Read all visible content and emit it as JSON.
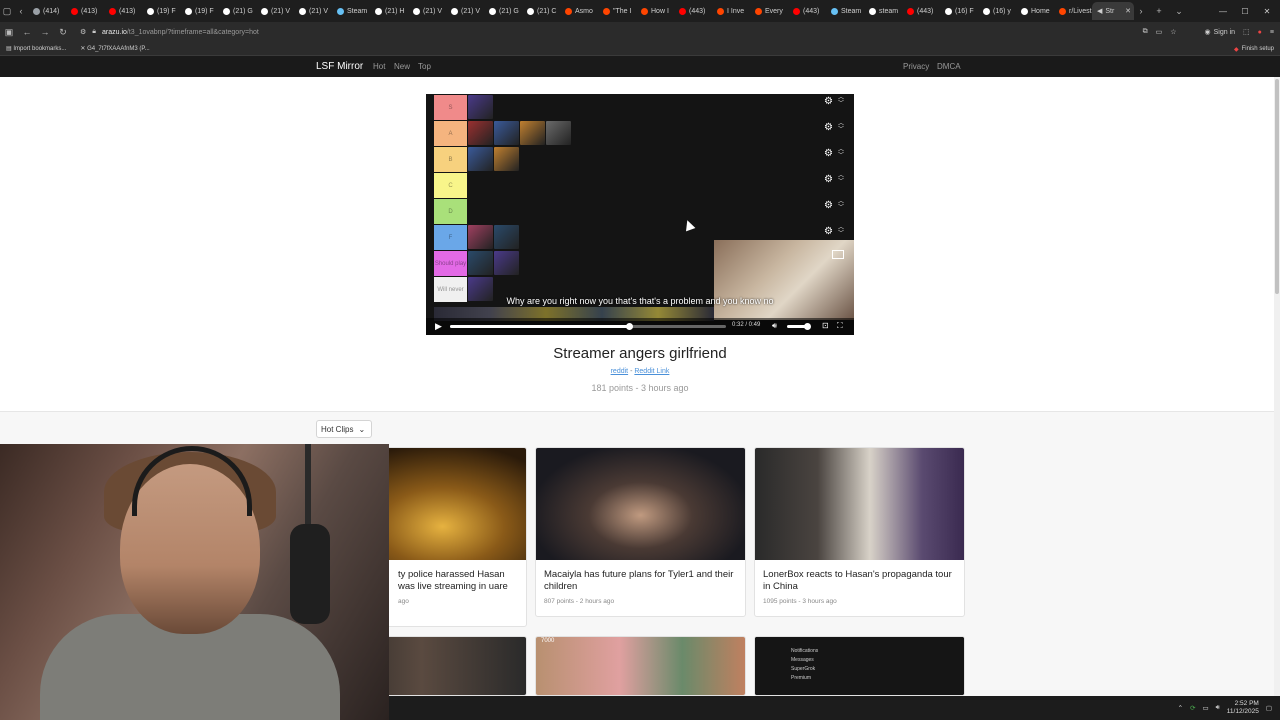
{
  "browser": {
    "tabs": [
      {
        "label": "(414)",
        "icon": "circle-icon",
        "color": "#9aa0a6"
      },
      {
        "label": "(413)",
        "icon": "youtube-icon",
        "color": "#ff0000"
      },
      {
        "label": "(413)",
        "icon": "youtube-icon",
        "color": "#ff0000"
      },
      {
        "label": "(19) F",
        "icon": "x-icon",
        "color": "#ffffff"
      },
      {
        "label": "(19) F",
        "icon": "x-icon",
        "color": "#ffffff"
      },
      {
        "label": "(21) G",
        "icon": "x-icon",
        "color": "#ffffff"
      },
      {
        "label": "(21) V",
        "icon": "x-icon",
        "color": "#ffffff"
      },
      {
        "label": "(21) V",
        "icon": "x-icon",
        "color": "#ffffff"
      },
      {
        "label": "Steam",
        "icon": "steam-icon",
        "color": "#66c0f4"
      },
      {
        "label": "(21) H",
        "icon": "x-icon",
        "color": "#ffffff"
      },
      {
        "label": "(21) V",
        "icon": "x-icon",
        "color": "#ffffff"
      },
      {
        "label": "(21) V",
        "icon": "x-icon",
        "color": "#ffffff"
      },
      {
        "label": "(21) G",
        "icon": "x-icon",
        "color": "#ffffff"
      },
      {
        "label": "(21) C",
        "icon": "x-icon",
        "color": "#ffffff"
      },
      {
        "label": "Asmo",
        "icon": "reddit-icon",
        "color": "#ff4500"
      },
      {
        "label": "\"The I",
        "icon": "reddit-icon",
        "color": "#ff4500"
      },
      {
        "label": "How I",
        "icon": "reddit-icon",
        "color": "#ff4500"
      },
      {
        "label": "(443)",
        "icon": "youtube-icon",
        "color": "#ff0000"
      },
      {
        "label": "I Inve",
        "icon": "reddit-icon",
        "color": "#ff4500"
      },
      {
        "label": "Every",
        "icon": "reddit-icon",
        "color": "#ff4500"
      },
      {
        "label": "(443)",
        "icon": "youtube-icon",
        "color": "#ff0000"
      },
      {
        "label": "Steam",
        "icon": "steam-icon",
        "color": "#66c0f4"
      },
      {
        "label": "steam",
        "icon": "google-icon",
        "color": "#ffffff"
      },
      {
        "label": "(443)",
        "icon": "youtube-icon",
        "color": "#ff0000"
      },
      {
        "label": "(16) F",
        "icon": "x-icon",
        "color": "#ffffff"
      },
      {
        "label": "(16) y",
        "icon": "x-icon",
        "color": "#ffffff"
      },
      {
        "label": "Home",
        "icon": "x-icon",
        "color": "#ffffff"
      },
      {
        "label": "r/Livest",
        "icon": "reddit-icon",
        "color": "#ff4500"
      }
    ],
    "active_tab": {
      "label": "Str",
      "icon": "speaker-icon"
    },
    "new_tab": "+",
    "url_host": "arazu.io",
    "url_path": "/t3_1ovabnp/?timeframe=all&category=hot",
    "sign_in": "Sign in",
    "bookmarks": [
      "Import bookmarks...",
      "G4_7t7fXAAAfnM3 (P..."
    ],
    "finish_setup": "Finish setup",
    "window_controls": {
      "minimize": "—",
      "maximize": "☐",
      "close": "✕"
    }
  },
  "site": {
    "brand": "LSF Mirror",
    "nav": [
      "Hot",
      "New",
      "Top"
    ],
    "nav_right": [
      "Privacy",
      "DMCA"
    ]
  },
  "video": {
    "tiers": [
      {
        "label": "S",
        "color": "#f08a8a"
      },
      {
        "label": "A",
        "color": "#f5b47f"
      },
      {
        "label": "B",
        "color": "#f7d17e"
      },
      {
        "label": "C",
        "color": "#f8f58a"
      },
      {
        "label": "D",
        "color": "#a9e07a"
      },
      {
        "label": "F",
        "color": "#6aa7e8"
      },
      {
        "label": "Should play",
        "color": "#e36ae6"
      },
      {
        "label": "Will never",
        "color": "#f0f0f0"
      }
    ],
    "subtitle": "Why are you right now you that's that's a problem and you know no",
    "time": "0:32 / 0:49",
    "progress": 0.65,
    "volume": 0.8
  },
  "post": {
    "title": "Streamer angers girlfriend",
    "link1": "reddit",
    "separator": "-",
    "link2": "Reddit Link",
    "meta": "181 points - 3 hours ago"
  },
  "feed": {
    "sort_label": "Hot Clips",
    "cards": [
      {
        "title": "ty police harassed Hasan was live streaming in uare",
        "meta": "ago",
        "thumb": "#6a4a20"
      },
      {
        "title": "Macaiyla has future plans for Tyler1 and their children",
        "meta": "807 points - 2 hours ago",
        "thumb": "#2a2a30"
      },
      {
        "title": "LonerBox reacts to Hasan's propaganda tour in China",
        "meta": "1095 points - 3 hours ago",
        "thumb": "#3a3632"
      }
    ],
    "bottom_cards": [
      {
        "thumb": "#2e2e2e"
      },
      {
        "thumb": "#8a6a5a",
        "label": "7000"
      },
      {
        "thumb": "#151515",
        "menu": [
          "Notifications",
          "Messages",
          "SuperGrok",
          "Premium"
        ]
      }
    ]
  },
  "taskbar": {
    "time": "2:52 PM",
    "date": "11/12/2025"
  }
}
